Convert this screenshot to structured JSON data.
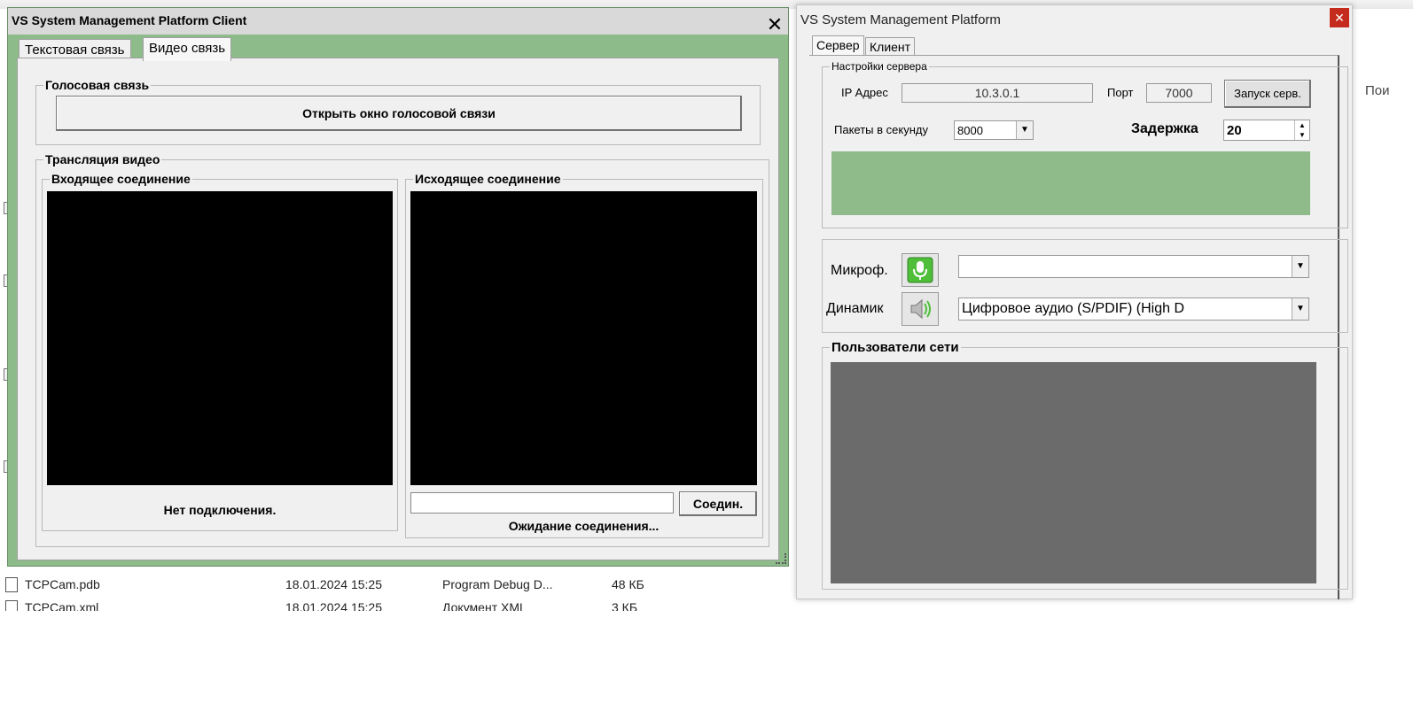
{
  "background": {
    "files": [
      {
        "name": "TCPCam.pdb",
        "date": "18.01.2024 15:25",
        "type": "Program Debug D...",
        "size": "48 КБ"
      },
      {
        "name": "TCPCam.xml",
        "date": "18.01.2024 15:25",
        "type": "Документ XML",
        "size": "3 КБ"
      }
    ],
    "search_partial": "Пои"
  },
  "client": {
    "title": "VS System Management Platform Client",
    "close": "✕",
    "tabs": [
      "Текстовая связь",
      "Видео связь"
    ],
    "voice_group": "Голосовая связь",
    "open_voice_button": "Открыть окно голосовой связи",
    "video_group": "Трансляция видео",
    "incoming_group": "Входящее соединение",
    "incoming_status": "Нет подключения.",
    "outgoing_group": "Исходящее соединение",
    "outgoing_input": "",
    "connect_button": "Соедин.",
    "outgoing_status": "Ожидание соединения..."
  },
  "server": {
    "title": "VS System Management Platform",
    "close": "✕",
    "tabs": [
      "Сервер",
      "Клиент"
    ],
    "settings_group": "Настройки сервера",
    "ip_label": "IP Адрес",
    "ip_value": "10.3.0.1",
    "port_label": "Порт",
    "port_value": "7000",
    "start_button": "Запуск серв.",
    "packets_label": "Пакеты в секунду",
    "packets_value": "8000",
    "delay_label": "Задержка",
    "delay_value": "20",
    "mic_label": "Микроф.",
    "mic_value": "",
    "speaker_label": "Динамик",
    "speaker_value": "Цифровое аудио (S/PDIF) (High D",
    "users_group": "Пользователи сети",
    "colors": {
      "status_green": "#8fbb8a",
      "users_bg": "#6b6b6b",
      "client_frame": "#8dbb8a"
    }
  }
}
